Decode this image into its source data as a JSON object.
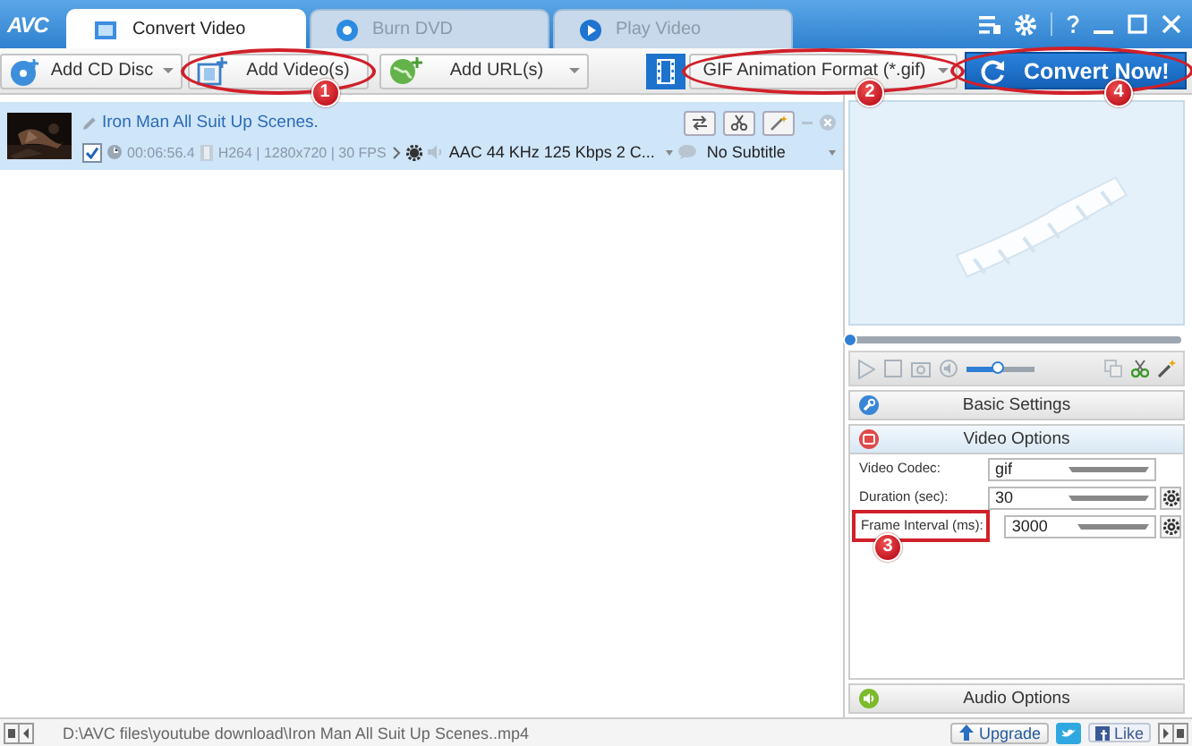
{
  "app": {
    "logo": "AVC"
  },
  "tabs": [
    {
      "label": "Convert Video",
      "selected": true
    },
    {
      "label": "Burn DVD",
      "selected": false
    },
    {
      "label": "Play Video",
      "selected": false
    }
  ],
  "toolbar": {
    "buttons": [
      {
        "kind": "disc",
        "label": "Add CD Disc"
      },
      {
        "kind": "video",
        "label": "Add Video(s)",
        "callout": {
          "number": "1",
          "kind": "ellipse"
        }
      },
      {
        "kind": "url",
        "label": "Add URL(s)"
      }
    ],
    "format": {
      "label": "GIF Animation Format (*.gif)",
      "callout": {
        "number": "2",
        "kind": "ellipse"
      }
    },
    "convert": {
      "label": "Convert Now!",
      "callout": {
        "number": "4",
        "kind": "ellipse"
      }
    }
  },
  "files": [
    {
      "title": "Iron Man All Suit Up Scenes.",
      "checked": true,
      "duration": "00:06:56.4",
      "video_info": "H264 | 1280x720 | 30 FPS",
      "audio": "AAC 44 KHz 125 Kbps 2 C...",
      "subtitle": "No Subtitle"
    }
  ],
  "player": {
    "seek": {
      "level": 0
    },
    "volume": {
      "level": 0.45
    }
  },
  "settings": {
    "sections": [
      {
        "kind": "basic",
        "title": "Basic Settings",
        "expanded": false
      },
      {
        "kind": "video",
        "title": "Video Options",
        "expanded": true,
        "rows": [
          {
            "label": "Video Codec:",
            "value": "gif",
            "gear": false
          },
          {
            "label": "Duration (sec):",
            "value": "30",
            "gear": true
          },
          {
            "label": "Frame Interval (ms):",
            "value": "3000",
            "gear": true,
            "callout": {
              "number": "3",
              "kind": "box"
            }
          }
        ]
      },
      {
        "kind": "audio",
        "title": "Audio Options",
        "expanded": false
      }
    ]
  },
  "status_bar": {
    "path": "D:\\AVC files\\youtube download\\Iron Man All Suit Up Scenes..mp4",
    "upgrade": "Upgrade",
    "like": "Like"
  }
}
